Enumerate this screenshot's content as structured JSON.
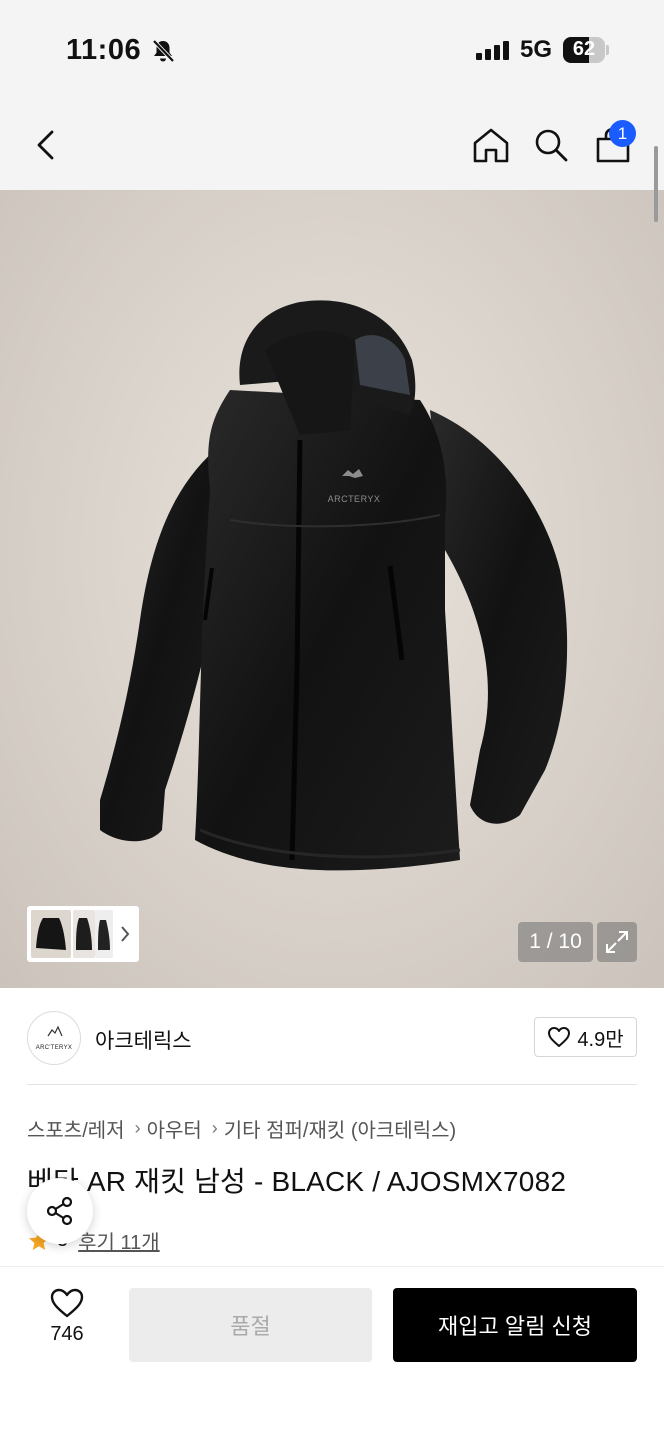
{
  "status_bar": {
    "time": "11:06",
    "network": "5G",
    "battery": "62",
    "battery_level": 0.62,
    "icons": [
      "bell-off-icon",
      "signal-icon",
      "battery-icon"
    ]
  },
  "nav": {
    "icons": [
      "chevron-left-icon",
      "home-icon",
      "search-icon",
      "shopping-bag-icon"
    ],
    "cart_badge": "1",
    "badge_color": "#1a5cff"
  },
  "gallery": {
    "counter": "1 / 10",
    "icons": [
      "jacket-photo",
      "chevron-right-icon",
      "expand-icon"
    ]
  },
  "brand": {
    "logo_text": "ARC'TERYX",
    "name": "아크테릭스",
    "likes": "4.9만"
  },
  "breadcrumb": [
    "스포츠/레저",
    "아우터",
    "기타 점퍼/재킷 (아크테릭스)"
  ],
  "product": {
    "title": "베타 AR 재킷 남성 - BLACK / AJOSMX7082",
    "rating": "5",
    "review_link": "후기 11개",
    "star_color": "#f5a623"
  },
  "bottom_bar": {
    "wish_count": "746",
    "soldout_label": "품절",
    "restock_label": "재입고 알림 신청"
  }
}
